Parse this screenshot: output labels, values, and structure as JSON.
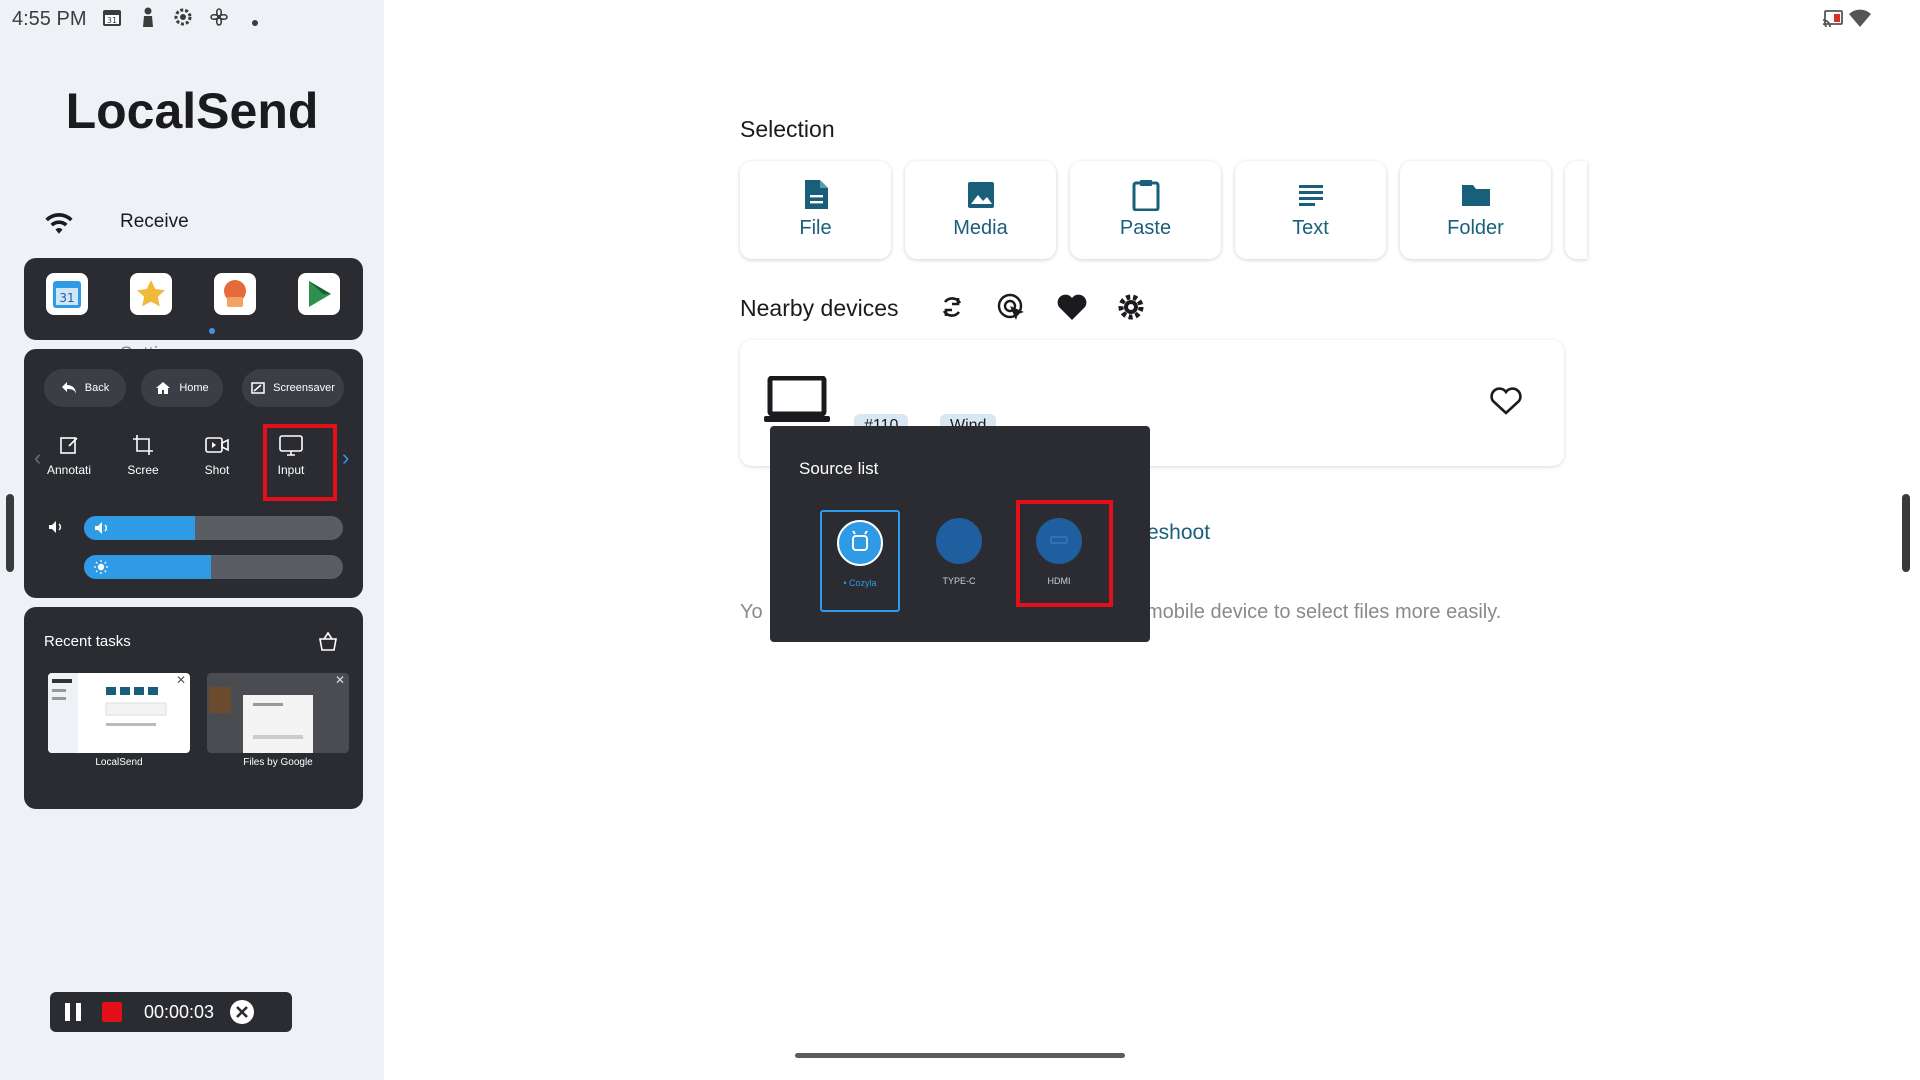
{
  "status_bar": {
    "time": "4:55 PM"
  },
  "app": {
    "title": "LocalSend"
  },
  "nav": {
    "receive": "Receive",
    "settings": "Settings"
  },
  "controls": {
    "back": "Back",
    "home": "Home",
    "screensaver": "Screensaver",
    "tools": [
      "Annotati",
      "Scree",
      "Shot",
      "Input"
    ],
    "volume_level": 0.43,
    "brightness_level": 0.49
  },
  "recent_tasks": {
    "title": "Recent tasks",
    "items": [
      "LocalSend",
      "Files by Google"
    ]
  },
  "recording": {
    "time": "00:00:03"
  },
  "selection": {
    "title": "Selection",
    "items": [
      "File",
      "Media",
      "Paste",
      "Text",
      "Folder"
    ]
  },
  "nearby": {
    "title": "Nearby devices",
    "chips": [
      "#110",
      "Wind"
    ]
  },
  "troubleshoot": "eshoot",
  "hint": {
    "left": "Yo",
    "right": "ur mobile device to select files more easily."
  },
  "source_list": {
    "title": "Source list",
    "items": [
      "• Cozyla",
      "TYPE-C",
      "HDMI"
    ]
  },
  "colors": {
    "accent": "#1a5f7a",
    "panel": "#2a2c32",
    "highlight": "#e3101a",
    "selected": "#2f9ae6"
  }
}
